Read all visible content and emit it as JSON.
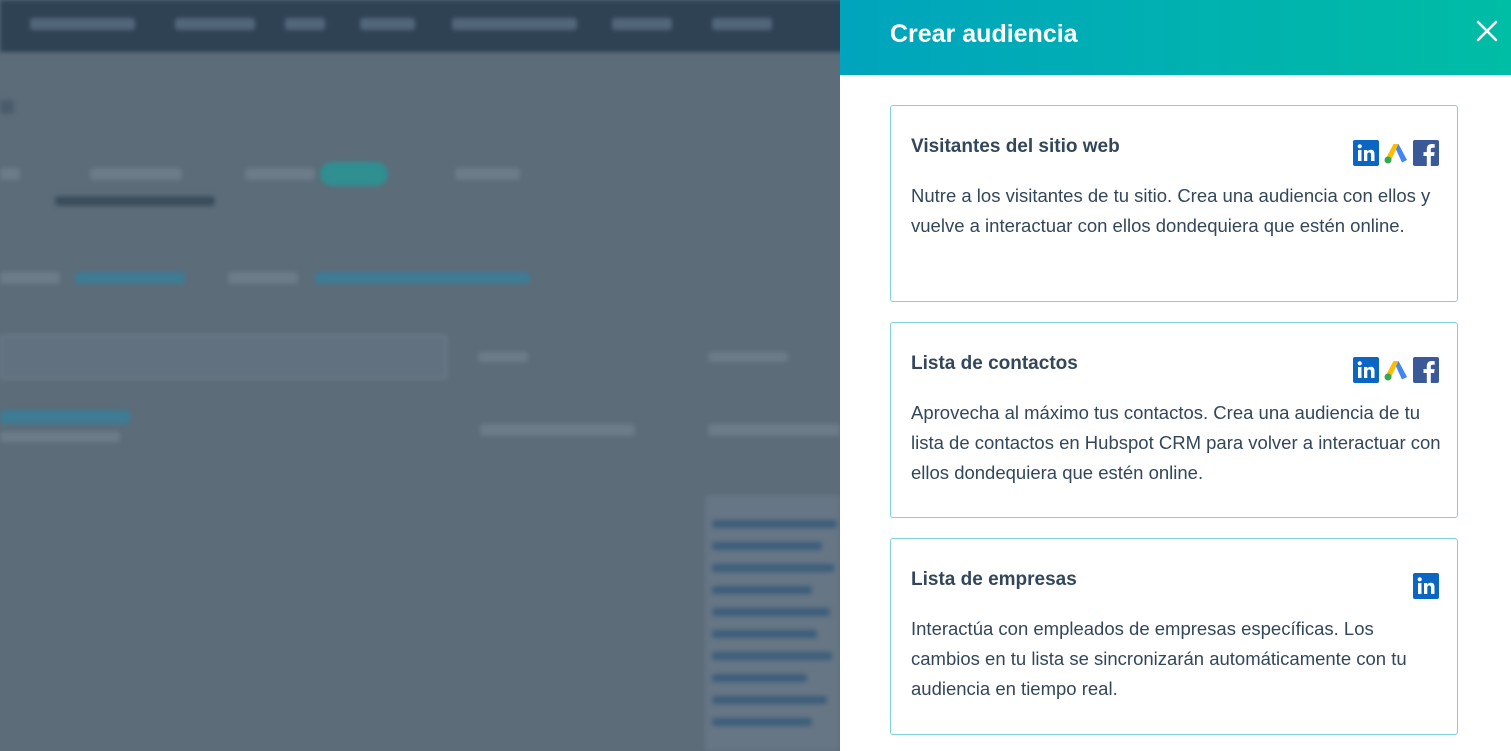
{
  "panel": {
    "title": "Crear audiencia",
    "close_icon": "close-icon"
  },
  "cards": [
    {
      "title": "Visitantes del sitio web",
      "description": "Nutre a los visitantes de tu sitio. Crea una audiencia con ellos y vuelve a interactuar con ellos dondequiera que estén online.",
      "icons": [
        "linkedin-icon",
        "google-ads-icon",
        "facebook-icon"
      ]
    },
    {
      "title": "Lista de contactos",
      "description": "Aprovecha al máximo tus contactos. Crea una audiencia de tu lista de contactos en Hubspot CRM para volver a interactuar con ellos dondequiera que estén online.",
      "icons": [
        "linkedin-icon",
        "google-ads-icon",
        "facebook-icon"
      ]
    },
    {
      "title": "Lista de empresas",
      "description": "Interactúa con empleados de empresas específicas. Los cambios en tu lista se sincronizarán automáticamente con tu audiencia en tiempo real.",
      "icons": [
        "linkedin-icon"
      ]
    }
  ],
  "colors": {
    "header_gradient_start": "#00a4bd",
    "header_gradient_end": "#00bda5",
    "card_border": "#7fd1de",
    "text": "#33475b",
    "linkedin": "#0a66c2",
    "facebook": "#3b5998"
  }
}
